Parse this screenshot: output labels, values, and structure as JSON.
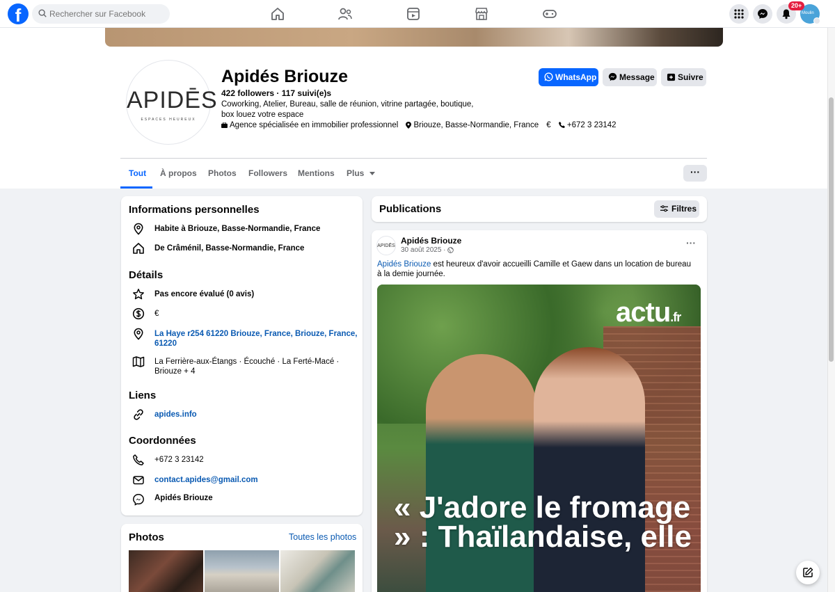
{
  "topbar": {
    "logo": "f",
    "search_placeholder": "Rechercher sur Facebook",
    "notif_badge": "20+",
    "avatar_label": "Moulin"
  },
  "page": {
    "name": "Apidés Briouze",
    "followers": "422 followers",
    "following": "117 suivi(e)s",
    "category": "Coworking, Atelier, Bureau, salle de réunion, vitrine partagée, boutique, box louez votre espace",
    "meta_agency": "Agence spécialisée en immobilier professionnel",
    "meta_location": "Briouze, Basse-Normandie, France",
    "meta_price": "€",
    "meta_phone": "+672 3 23142",
    "logo_text": "APIDĒS",
    "logo_sub": "ESPACES HEUREUX"
  },
  "actions": {
    "whatsapp": "WhatsApp",
    "message": "Message",
    "follow": "Suivre"
  },
  "tabs": [
    "Tout",
    "À propos",
    "Photos",
    "Followers",
    "Mentions",
    "Plus"
  ],
  "more_label": "···",
  "info": {
    "personal_title": "Informations personnelles",
    "lives": "Habite à Briouze, Basse-Normandie, France",
    "from": "De Crâménil, Basse-Normandie, France",
    "details_title": "Détails",
    "rating": "Pas encore évalué (0 avis)",
    "price": "€",
    "address": "La Haye r254 61220 Briouze, France, Briouze, France, 61220",
    "area": "La Ferrière-aux-Étangs · Écouché · La Ferté-Macé · Briouze + 4",
    "links_title": "Liens",
    "website": "apides.info",
    "contact_title": "Coordonnées",
    "phone": "+672 3 23142",
    "email": "contact.apides@gmail.com",
    "messenger": "Apidés Briouze"
  },
  "photos": {
    "title": "Photos",
    "all_link": "Toutes les photos"
  },
  "publications": {
    "title": "Publications",
    "filters": "Filtres"
  },
  "post": {
    "avatar_text": "APIDĒS",
    "author": "Apidés Briouze",
    "date": "30 août 2025 · ",
    "mention": "Apidés Briouze",
    "text": " est heureux d'avoir accueilli Camille et Gaew dans un location de bureau à la demie journée.",
    "image_brand": "actu",
    "image_brand_suffix": ".fr",
    "image_headline": "« J'adore le fromage » : Thaïlandaise, elle"
  },
  "colors": {
    "accent": "#0866ff",
    "link": "#0a5ab2",
    "background": "#f0f2f5"
  }
}
